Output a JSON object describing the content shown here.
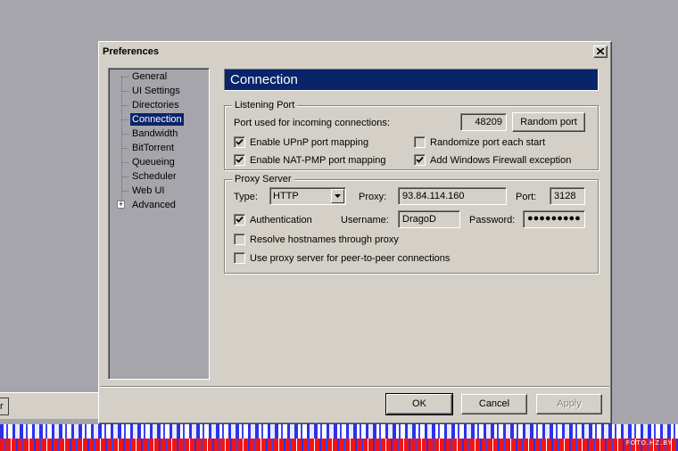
{
  "dialog": {
    "title": "Preferences",
    "close_icon": "close-icon"
  },
  "nav": {
    "items": [
      {
        "label": "General"
      },
      {
        "label": "UI Settings"
      },
      {
        "label": "Directories"
      },
      {
        "label": "Connection",
        "selected": true
      },
      {
        "label": "Bandwidth"
      },
      {
        "label": "BitTorrent"
      },
      {
        "label": "Queueing"
      },
      {
        "label": "Scheduler"
      },
      {
        "label": "Web UI"
      },
      {
        "label": "Advanced",
        "expandable": true
      }
    ],
    "expander_symbol": "+"
  },
  "panel": {
    "title": "Connection"
  },
  "listening": {
    "group_label": "Listening Port",
    "port_label": "Port used for incoming connections:",
    "port_value": "48209",
    "random_port_label": "Random port",
    "upnp_label": "Enable UPnP port mapping",
    "upnp_checked": true,
    "natpmp_label": "Enable NAT-PMP port mapping",
    "natpmp_checked": true,
    "randomize_label": "Randomize port each start",
    "randomize_checked": false,
    "firewall_label": "Add Windows Firewall exception",
    "firewall_checked": true
  },
  "proxy": {
    "group_label": "Proxy Server",
    "type_label": "Type:",
    "type_value": "HTTP",
    "proxy_label": "Proxy:",
    "proxy_value": "93.84.114.160",
    "port_label": "Port:",
    "port_value": "3128",
    "auth_label": "Authentication",
    "auth_checked": true,
    "username_label": "Username:",
    "username_value": "DragoD",
    "password_label": "Password:",
    "password_value": "●●●●●●●●●",
    "resolve_label": "Resolve hostnames through proxy",
    "resolve_checked": false,
    "p2p_label": "Use proxy server for peer-to-peer connections",
    "p2p_checked": false
  },
  "buttons": {
    "ok": "OK",
    "cancel": "Cancel",
    "apply": "Apply"
  },
  "background": {
    "left_button_text": "r",
    "watermark": "FOTO.HZ.BY"
  },
  "colors": {
    "selection": "#0a246a",
    "dialog_face": "#d4d0c8",
    "desktop": "#a6a5ab",
    "pieces_blue": "#2a33e8",
    "pieces_red": "#f21414"
  }
}
